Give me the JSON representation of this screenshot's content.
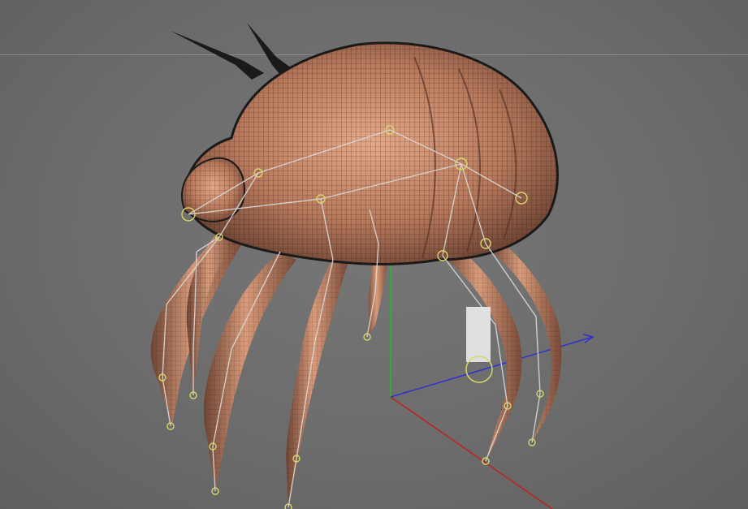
{
  "viewport": {
    "background_color": "#6b6b6b",
    "grid_line_color": "#8c8c8c",
    "axis_colors": {
      "x": "#c02020",
      "y": "#20c020",
      "z": "#3030d0"
    },
    "joint_color": "#d6d66a",
    "bone_color": "#d8d8d8",
    "skin_color": "#c98a66",
    "wire_color": "#1a1a1a",
    "manipulator_color": "#e8e8e8"
  }
}
